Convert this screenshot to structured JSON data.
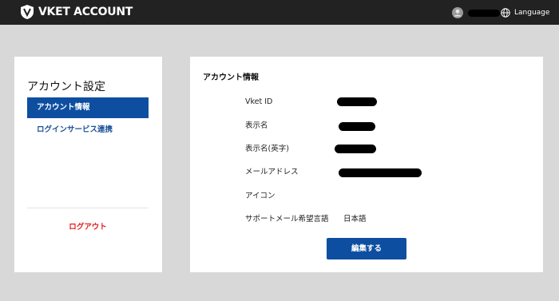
{
  "header": {
    "brand": "VKET ACCOUNT",
    "language_label": "Language",
    "colors": {
      "background": "#222222",
      "text": "#ffffff"
    }
  },
  "sidebar": {
    "title": "アカウント設定",
    "items": [
      {
        "label": "アカウント情報",
        "active": true
      },
      {
        "label": "ログインサービス連携",
        "active": false
      }
    ],
    "logout_label": "ログアウト",
    "colors": {
      "active_bg": "#0d4ea1",
      "link": "#1a4f97",
      "logout": "#e02020"
    }
  },
  "main": {
    "title": "アカウント情報",
    "fields": [
      {
        "label": "Vket ID",
        "redacted": true
      },
      {
        "label": "表示名",
        "redacted": true
      },
      {
        "label": "表示名(英字)",
        "redacted": true
      },
      {
        "label": "メールアドレス",
        "redacted": true
      },
      {
        "label": "アイコン",
        "value": ""
      },
      {
        "label": "サポートメール希望言語",
        "value": "日本語"
      }
    ],
    "edit_button_label": "編集する"
  },
  "icons": {
    "logo": "shield-logo-icon",
    "avatar": "user-avatar-icon",
    "language": "globe-icon"
  }
}
